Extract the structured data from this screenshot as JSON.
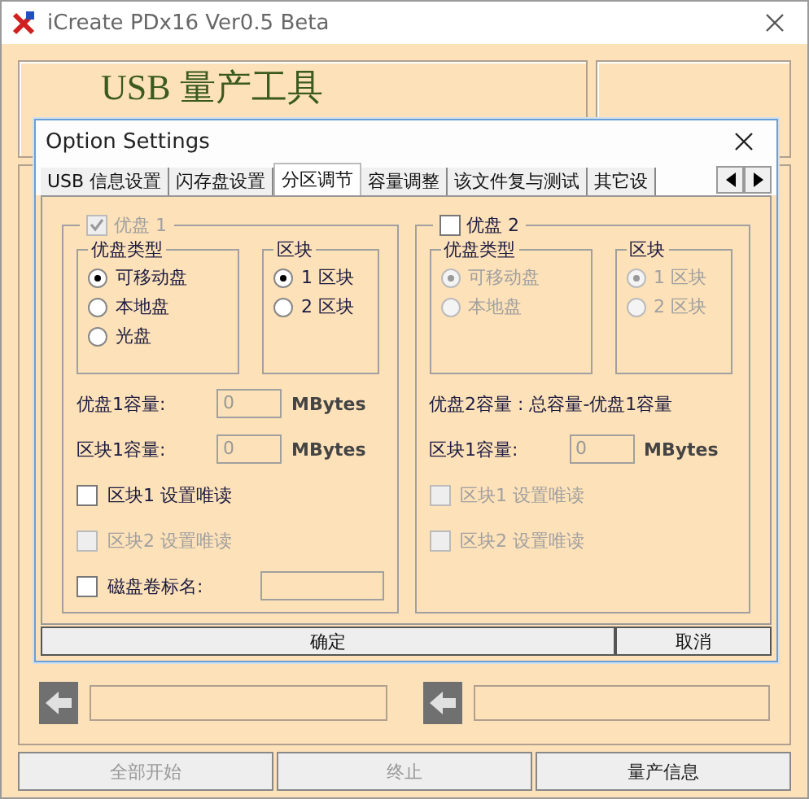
{
  "window": {
    "title": "iCreate PDx16 Ver0.5 Beta"
  },
  "logo": {
    "text": "USB 量产工具"
  },
  "slots": [
    {
      "level": 0
    },
    {
      "level": 0
    }
  ],
  "buttons": [
    {
      "label": "全部开始",
      "disabled": true
    },
    {
      "label": "终止",
      "disabled": true
    },
    {
      "label": "量产信息",
      "disabled": false
    }
  ],
  "dialog": {
    "title": "Option Settings",
    "tabs": [
      {
        "label": "USB 信息设置",
        "selected": false
      },
      {
        "label": "闪存盘设置",
        "selected": false
      },
      {
        "label": "分区调节",
        "selected": true
      },
      {
        "label": "容量调整",
        "selected": false
      },
      {
        "label": "该文件复与测试",
        "selected": false
      },
      {
        "label": "其它设",
        "selected": false
      }
    ],
    "disks": [
      {
        "label": "优盘 1",
        "checked": true,
        "disabled": true,
        "groups": [
          {
            "title": "优盘类型",
            "disabled": false,
            "options": [
              {
                "label": "可移动盘",
                "selected": true
              },
              {
                "label": "本地盘",
                "selected": false
              },
              {
                "label": "光盘",
                "selected": false
              }
            ]
          },
          {
            "title": "区块",
            "disabled": false,
            "options": [
              {
                "label": "1 区块",
                "selected": true
              },
              {
                "label": "2 区块",
                "selected": false
              }
            ]
          }
        ],
        "rows": [
          {
            "kind": "capacity",
            "label": "优盘1容量:",
            "value": "0",
            "unit": "MBytes",
            "disabled": true
          },
          {
            "kind": "capacity",
            "label": "区块1容量:",
            "value": "0",
            "unit": "MBytes",
            "disabled": true
          },
          {
            "kind": "checkbox",
            "label": "区块1 设置唯读",
            "checked": false,
            "disabled": false
          },
          {
            "kind": "checkbox",
            "label": "区块2 设置唯读",
            "checked": false,
            "disabled": true
          },
          {
            "kind": "checkfield",
            "label": "磁盘卷标名:",
            "checked": false,
            "disabled": false
          }
        ]
      },
      {
        "label": "优盘 2",
        "checked": false,
        "disabled": false,
        "groups": [
          {
            "title": "优盘类型",
            "disabled": true,
            "options": [
              {
                "label": "可移动盘",
                "selected": true
              },
              {
                "label": "本地盘",
                "selected": false
              }
            ]
          },
          {
            "title": "区块",
            "disabled": true,
            "options": [
              {
                "label": "1 区块",
                "selected": true
              },
              {
                "label": "2 区块",
                "selected": false
              }
            ]
          }
        ],
        "rows": [
          {
            "kind": "note",
            "label": "优盘2容量 : 总容量-优盘1容量"
          },
          {
            "kind": "capacity",
            "label": "区块1容量:",
            "value": "0",
            "unit": "MBytes",
            "disabled": true
          },
          {
            "kind": "checkbox",
            "label": "区块1 设置唯读",
            "checked": false,
            "disabled": true
          },
          {
            "kind": "checkbox",
            "label": "区块2 设置唯读",
            "checked": false,
            "disabled": true
          }
        ]
      }
    ],
    "buttons": [
      {
        "label": "确定"
      },
      {
        "label": "取消"
      }
    ]
  }
}
